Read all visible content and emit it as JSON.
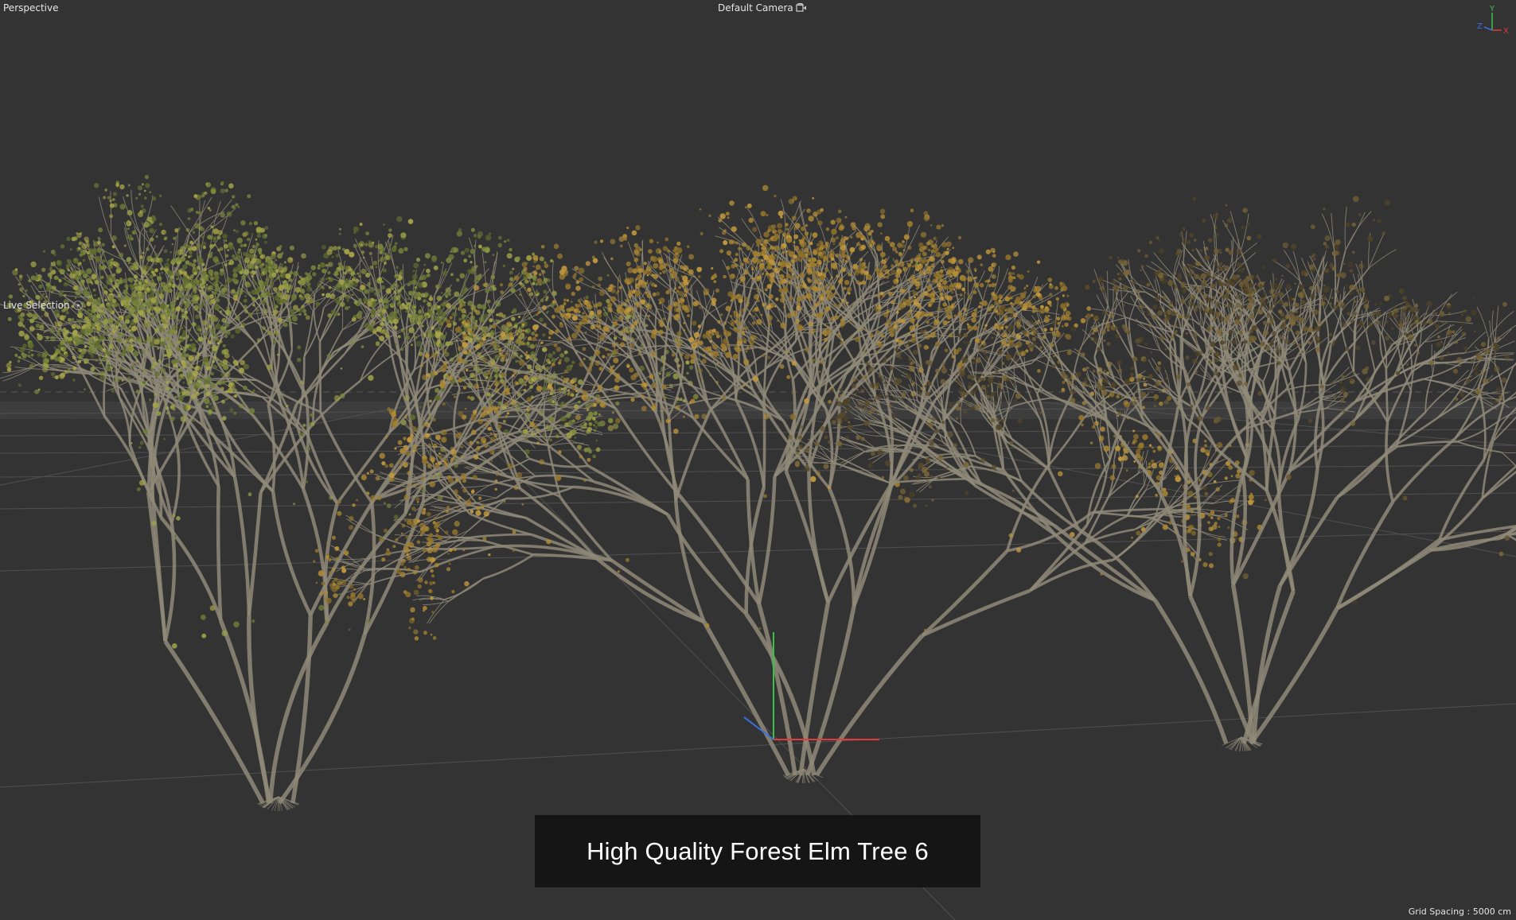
{
  "viewport": {
    "view_name": "Perspective",
    "camera_name": "Default Camera",
    "active_tool": "Live Selection",
    "grid_spacing": "Grid Spacing : 5000 cm",
    "background_color": "#333333",
    "icons": {
      "camera": "camera-icon",
      "tool": "live-selection-icon",
      "axis": "axis-gizmo-icon"
    }
  },
  "axis_gizmo": {
    "y_label": "Y",
    "x_label": "X",
    "z_label": "Z",
    "y_color": "#39c24a",
    "x_color": "#e23b3b",
    "z_color": "#3b6fe2"
  },
  "scene": {
    "trees": [
      {
        "name": "elm-tree-summer",
        "foliage_colors": [
          "#7e8a3c",
          "#98a048",
          "#5f6c2e",
          "#a9a548",
          "#6d7a3a"
        ]
      },
      {
        "name": "elm-tree-autumn",
        "foliage_colors": [
          "#b08a34",
          "#9c7a2c",
          "#c49a3e",
          "#8a6e2a",
          "#a88633"
        ]
      },
      {
        "name": "elm-tree-bare",
        "foliage_colors": [
          "#6b5a33",
          "#5a4a2a",
          "#7a6638",
          "#4e4226"
        ]
      }
    ],
    "branch_color": "#8f8a78",
    "grid_color": "#505050"
  },
  "banner": {
    "title": "High Quality Forest Elm Tree 6",
    "background": "#151515"
  }
}
